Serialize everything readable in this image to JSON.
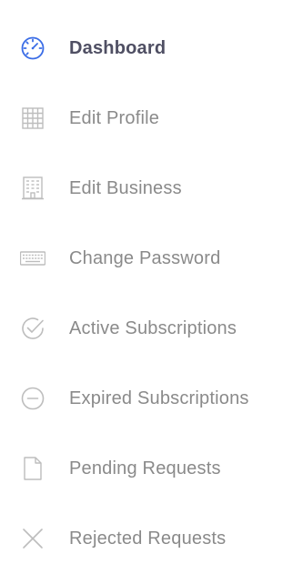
{
  "menu": {
    "accent_color": "#3b6de6",
    "muted_color": "#bdbdbd",
    "items": [
      {
        "label": "Dashboard",
        "icon": "gauge-icon",
        "active": true
      },
      {
        "label": "Edit Profile",
        "icon": "grid-icon",
        "active": false
      },
      {
        "label": "Edit Business",
        "icon": "building-icon",
        "active": false
      },
      {
        "label": "Change Password",
        "icon": "keyboard-icon",
        "active": false
      },
      {
        "label": "Active Subscriptions",
        "icon": "check-circle-icon",
        "active": false
      },
      {
        "label": "Expired Subscriptions",
        "icon": "minus-circle-icon",
        "active": false
      },
      {
        "label": "Pending Requests",
        "icon": "file-icon",
        "active": false
      },
      {
        "label": "Rejected Requests",
        "icon": "close-icon",
        "active": false
      }
    ]
  }
}
